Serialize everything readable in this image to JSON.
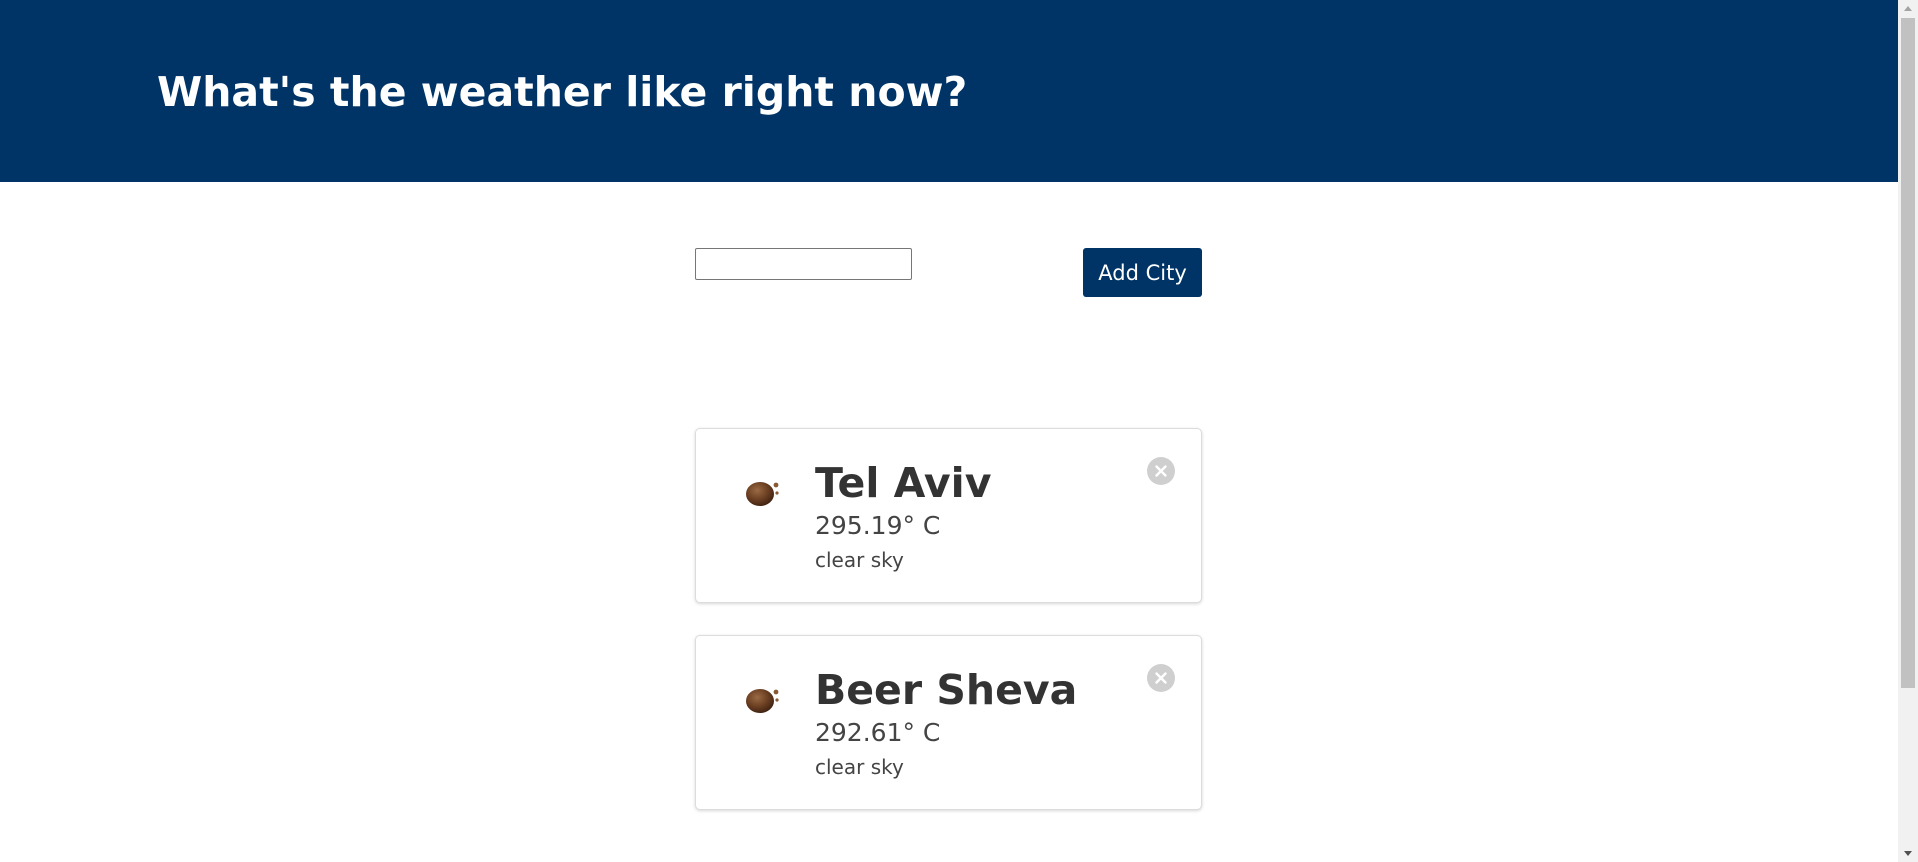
{
  "theme": {
    "brand_color": "#003366",
    "remove_button_color": "#cfcfcf",
    "icon_color": "#6b3f22"
  },
  "header": {
    "title": "What's the weather like right now?"
  },
  "add_city": {
    "input_value": "",
    "button_label": "Add City"
  },
  "cities": [
    {
      "name": "Tel Aviv",
      "temperature": "295.19° C",
      "description": "clear sky",
      "icon": "weather-icon-clear"
    },
    {
      "name": "Beer Sheva",
      "temperature": "292.61° C",
      "description": "clear sky",
      "icon": "weather-icon-clear"
    }
  ]
}
